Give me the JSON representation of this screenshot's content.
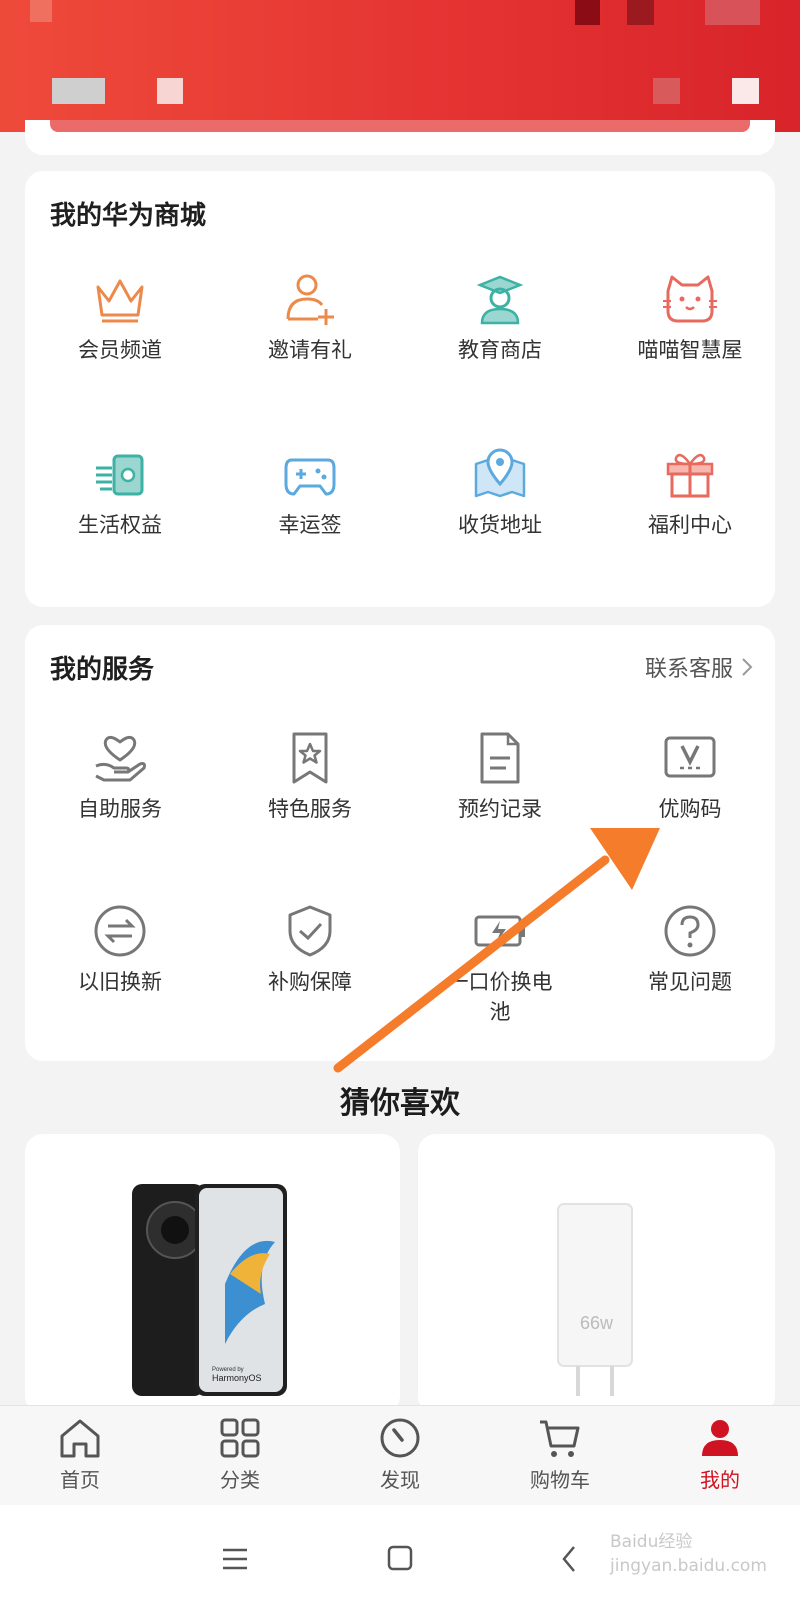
{
  "colors": {
    "accent_red": "#e43232",
    "active_tab": "#cf1322",
    "orange_arrow": "#f47c2a"
  },
  "my_mall": {
    "title": "我的华为商城",
    "items": [
      {
        "label": "会员频道",
        "icon": "crown-icon"
      },
      {
        "label": "邀请有礼",
        "icon": "invite-user-icon"
      },
      {
        "label": "教育商店",
        "icon": "graduate-icon"
      },
      {
        "label": "喵喵智慧屋",
        "icon": "cat-icon"
      },
      {
        "label": "生活权益",
        "icon": "coupon-stack-icon"
      },
      {
        "label": "幸运签",
        "icon": "gamepad-icon"
      },
      {
        "label": "收货地址",
        "icon": "map-pin-icon"
      },
      {
        "label": "福利中心",
        "icon": "gift-icon"
      }
    ]
  },
  "my_services": {
    "title": "我的服务",
    "contact_link": "联系客服",
    "items": [
      {
        "label": "自助服务",
        "icon": "heart-hand-icon"
      },
      {
        "label": "特色服务",
        "icon": "bookmark-star-icon"
      },
      {
        "label": "预约记录",
        "icon": "document-icon"
      },
      {
        "label": "优购码",
        "icon": "v-code-icon"
      },
      {
        "label": "以旧换新",
        "icon": "exchange-icon"
      },
      {
        "label": "补购保障",
        "icon": "shield-check-icon"
      },
      {
        "label": "一口价换电池",
        "icon": "battery-icon"
      },
      {
        "label": "常见问题",
        "icon": "question-icon"
      }
    ]
  },
  "recommend": {
    "title": "猜你喜欢",
    "products": [
      {
        "name": "phone",
        "os_text": "Powered by",
        "os_name": "HarmonyOS"
      },
      {
        "name": "charger",
        "watt": "66w"
      }
    ]
  },
  "tabbar": [
    {
      "label": "首页",
      "icon": "home-icon"
    },
    {
      "label": "分类",
      "icon": "grid-icon"
    },
    {
      "label": "发现",
      "icon": "compass-icon"
    },
    {
      "label": "购物车",
      "icon": "cart-icon"
    },
    {
      "label": "我的",
      "icon": "user-icon",
      "active": true
    }
  ],
  "watermark": "Baidu经验 jingyan.baidu.com"
}
